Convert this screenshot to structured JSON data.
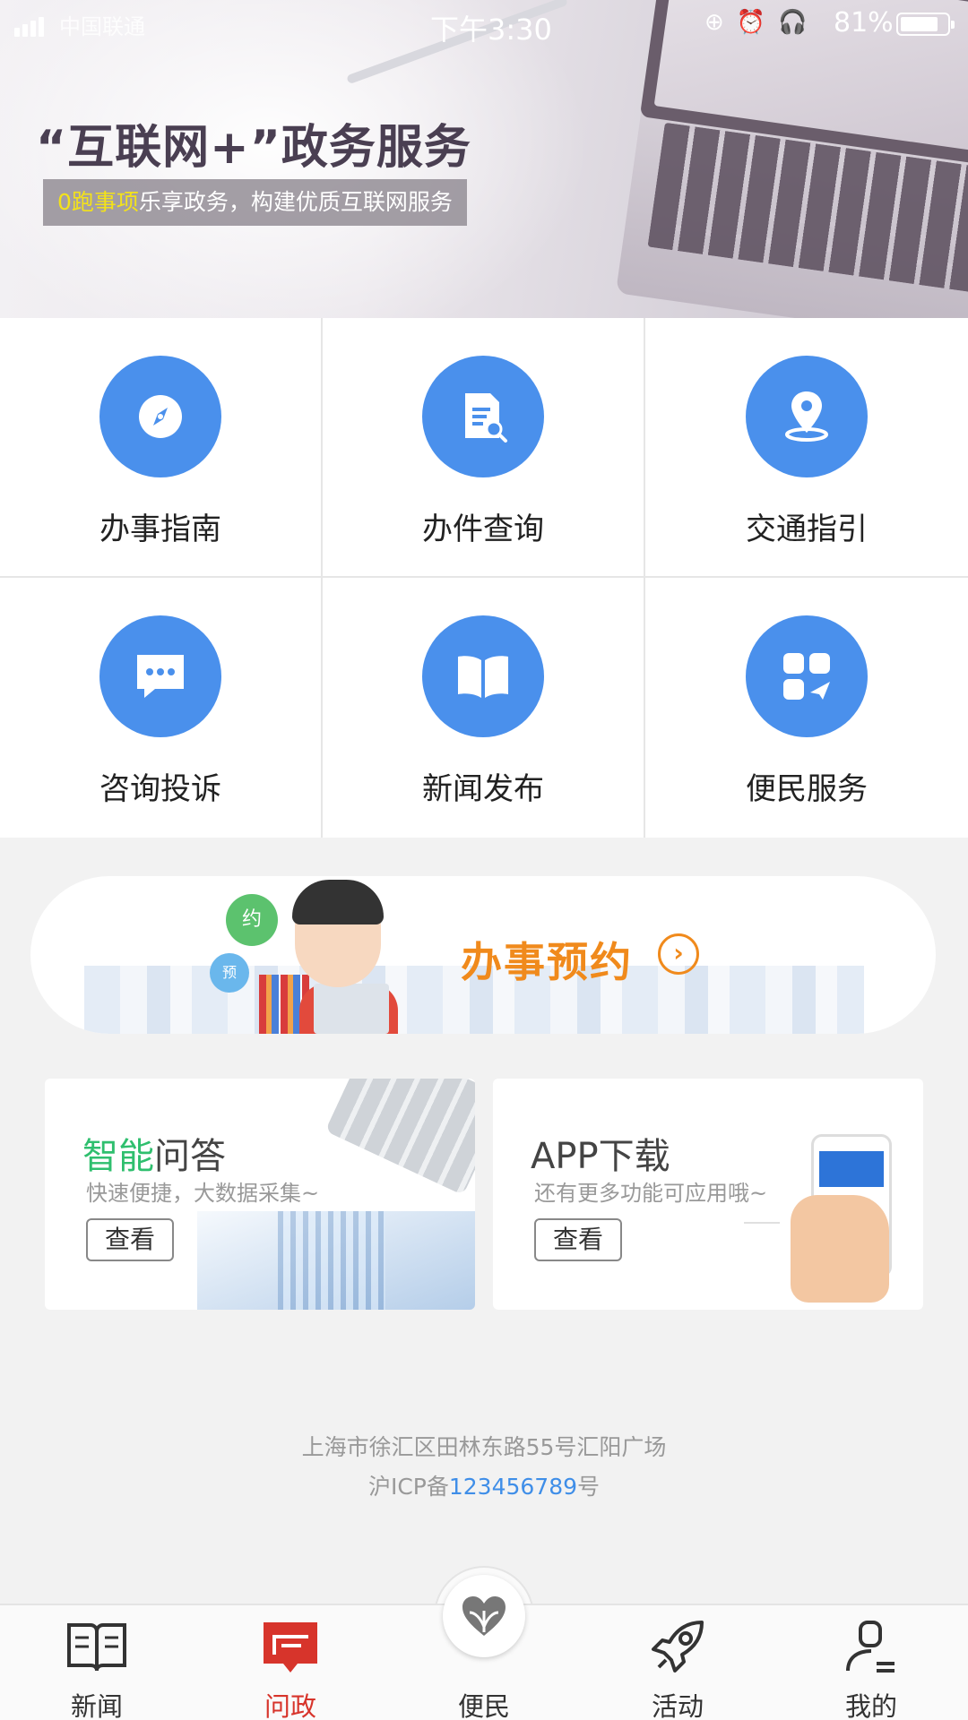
{
  "status_bar": {
    "carrier": "中国联通",
    "time": "下午3:30",
    "battery": "81%",
    "battery_level": 0.81
  },
  "banner": {
    "title": "“互联网+”政务服务",
    "subtitle_highlight": "0跑事项",
    "subtitle_rest": "乐享政务，构建优质互联网服务"
  },
  "services": [
    {
      "label": "办事指南",
      "icon": "compass-icon"
    },
    {
      "label": "办件查询",
      "icon": "document-search-icon"
    },
    {
      "label": "交通指引",
      "icon": "location-pin-icon"
    },
    {
      "label": "咨询投诉",
      "icon": "chat-bubble-icon"
    },
    {
      "label": "新闻发布",
      "icon": "open-book-icon"
    },
    {
      "label": "便民服务",
      "icon": "apps-grid-icon"
    }
  ],
  "appointment": {
    "title": "办事预约",
    "balloon_1": "约",
    "balloon_2": "预"
  },
  "cards": [
    {
      "title_highlight": "智能",
      "title_rest": "问答",
      "desc": "快速便捷，大数据采集~",
      "button": "查看"
    },
    {
      "title_highlight": "",
      "title_rest": "APP下载",
      "desc": "还有更多功能可应用哦~",
      "button": "查看"
    }
  ],
  "footer": {
    "address": "上海市徐汇区田林东路55号汇阳广场",
    "icp_prefix": "沪ICP备",
    "icp_number": "123456789",
    "icp_suffix": "号"
  },
  "tabs": [
    {
      "label": "新闻",
      "icon": "news-book-icon",
      "active": false
    },
    {
      "label": "问政",
      "icon": "politics-icon",
      "active": true
    },
    {
      "label": "便民",
      "icon": "heart-hands-icon",
      "active": false
    },
    {
      "label": "活动",
      "icon": "rocket-icon",
      "active": false
    },
    {
      "label": "我的",
      "icon": "user-icon",
      "active": false
    }
  ],
  "colors": {
    "accent_blue": "#4a90ec",
    "active_red": "#d7342b",
    "appointment_orange": "#f08a1c",
    "highlight_green": "#2fbf6e",
    "subtitle_yellow": "#f3e21a"
  }
}
